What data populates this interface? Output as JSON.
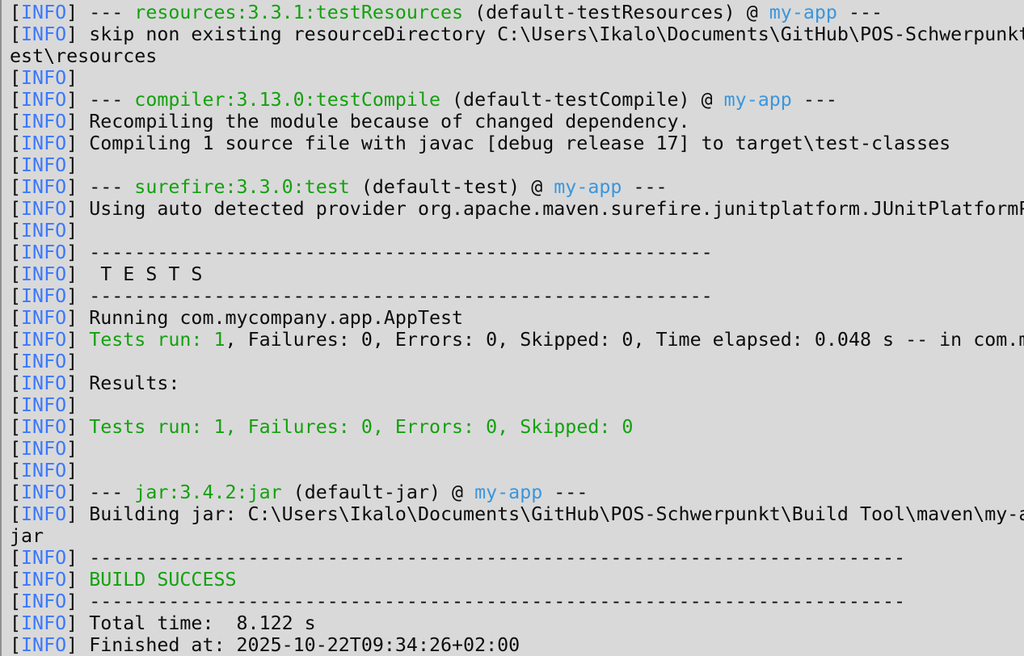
{
  "colors": {
    "background": "#d9d9d9",
    "default": "#0c0c0c",
    "blue": "#3b78ff",
    "green": "#13a10e",
    "cyan": "#3a96dd"
  },
  "lines": [
    [
      [
        "[",
        "default"
      ],
      [
        "INFO",
        "blue"
      ],
      [
        "] --- ",
        "default"
      ],
      [
        "resources:3.3.1:testResources",
        "green"
      ],
      [
        " (default-testResources) @ ",
        "default"
      ],
      [
        "my-app",
        "cyan"
      ],
      [
        " ---",
        "default"
      ]
    ],
    [
      [
        "[",
        "default"
      ],
      [
        "INFO",
        "blue"
      ],
      [
        "] skip non existing resourceDirectory C:\\Users\\Ikalo\\Documents\\GitHub\\POS-Schwerpunkt",
        "default"
      ]
    ],
    [
      [
        "est\\resources",
        "default"
      ]
    ],
    [
      [
        "[",
        "default"
      ],
      [
        "INFO",
        "blue"
      ],
      [
        "]",
        "default"
      ]
    ],
    [
      [
        "[",
        "default"
      ],
      [
        "INFO",
        "blue"
      ],
      [
        "] --- ",
        "default"
      ],
      [
        "compiler:3.13.0:testCompile",
        "green"
      ],
      [
        " (default-testCompile) @ ",
        "default"
      ],
      [
        "my-app",
        "cyan"
      ],
      [
        " ---",
        "default"
      ]
    ],
    [
      [
        "[",
        "default"
      ],
      [
        "INFO",
        "blue"
      ],
      [
        "] Recompiling the module because of changed dependency.",
        "default"
      ]
    ],
    [
      [
        "[",
        "default"
      ],
      [
        "INFO",
        "blue"
      ],
      [
        "] Compiling 1 source file with javac [debug release 17] to target\\test-classes",
        "default"
      ]
    ],
    [
      [
        "[",
        "default"
      ],
      [
        "INFO",
        "blue"
      ],
      [
        "]",
        "default"
      ]
    ],
    [
      [
        "[",
        "default"
      ],
      [
        "INFO",
        "blue"
      ],
      [
        "] --- ",
        "default"
      ],
      [
        "surefire:3.3.0:test",
        "green"
      ],
      [
        " (default-test) @ ",
        "default"
      ],
      [
        "my-app",
        "cyan"
      ],
      [
        " ---",
        "default"
      ]
    ],
    [
      [
        "[",
        "default"
      ],
      [
        "INFO",
        "blue"
      ],
      [
        "] Using auto detected provider org.apache.maven.surefire.junitplatform.JUnitPlatformP",
        "default"
      ]
    ],
    [
      [
        "[",
        "default"
      ],
      [
        "INFO",
        "blue"
      ],
      [
        "]",
        "default"
      ]
    ],
    [
      [
        "[",
        "default"
      ],
      [
        "INFO",
        "blue"
      ],
      [
        "] -------------------------------------------------------",
        "default"
      ]
    ],
    [
      [
        "[",
        "default"
      ],
      [
        "INFO",
        "blue"
      ],
      [
        "]  T E S T S",
        "default"
      ]
    ],
    [
      [
        "[",
        "default"
      ],
      [
        "INFO",
        "blue"
      ],
      [
        "] -------------------------------------------------------",
        "default"
      ]
    ],
    [
      [
        "[",
        "default"
      ],
      [
        "INFO",
        "blue"
      ],
      [
        "] Running com.mycompany.app.AppTest",
        "default"
      ]
    ],
    [
      [
        "[",
        "default"
      ],
      [
        "INFO",
        "blue"
      ],
      [
        "] ",
        "default"
      ],
      [
        "Tests run: 1",
        "green"
      ],
      [
        ", Failures: 0, Errors: 0, Skipped: 0, Time elapsed: 0.048 s -- in com.m",
        "default"
      ]
    ],
    [
      [
        "[",
        "default"
      ],
      [
        "INFO",
        "blue"
      ],
      [
        "]",
        "default"
      ]
    ],
    [
      [
        "[",
        "default"
      ],
      [
        "INFO",
        "blue"
      ],
      [
        "] Results:",
        "default"
      ]
    ],
    [
      [
        "[",
        "default"
      ],
      [
        "INFO",
        "blue"
      ],
      [
        "]",
        "default"
      ]
    ],
    [
      [
        "[",
        "default"
      ],
      [
        "INFO",
        "blue"
      ],
      [
        "] ",
        "default"
      ],
      [
        "Tests run: 1, Failures: 0, Errors: 0, Skipped: 0",
        "green"
      ]
    ],
    [
      [
        "[",
        "default"
      ],
      [
        "INFO",
        "blue"
      ],
      [
        "]",
        "default"
      ]
    ],
    [
      [
        "[",
        "default"
      ],
      [
        "INFO",
        "blue"
      ],
      [
        "]",
        "default"
      ]
    ],
    [
      [
        "[",
        "default"
      ],
      [
        "INFO",
        "blue"
      ],
      [
        "] --- ",
        "default"
      ],
      [
        "jar:3.4.2:jar",
        "green"
      ],
      [
        " (default-jar) @ ",
        "default"
      ],
      [
        "my-app",
        "cyan"
      ],
      [
        " ---",
        "default"
      ]
    ],
    [
      [
        "[",
        "default"
      ],
      [
        "INFO",
        "blue"
      ],
      [
        "] Building jar: C:\\Users\\Ikalo\\Documents\\GitHub\\POS-Schwerpunkt\\Build Tool\\maven\\my-a",
        "default"
      ]
    ],
    [
      [
        "jar",
        "default"
      ]
    ],
    [
      [
        "[",
        "default"
      ],
      [
        "INFO",
        "blue"
      ],
      [
        "] ------------------------------------------------------------------------",
        "default"
      ]
    ],
    [
      [
        "[",
        "default"
      ],
      [
        "INFO",
        "blue"
      ],
      [
        "] ",
        "default"
      ],
      [
        "BUILD SUCCESS",
        "green"
      ]
    ],
    [
      [
        "[",
        "default"
      ],
      [
        "INFO",
        "blue"
      ],
      [
        "] ------------------------------------------------------------------------",
        "default"
      ]
    ],
    [
      [
        "[",
        "default"
      ],
      [
        "INFO",
        "blue"
      ],
      [
        "] Total time:  8.122 s",
        "default"
      ]
    ],
    [
      [
        "[",
        "default"
      ],
      [
        "INFO",
        "blue"
      ],
      [
        "] Finished at: 2025-10-22T09:34:26+02:00",
        "default"
      ]
    ]
  ]
}
